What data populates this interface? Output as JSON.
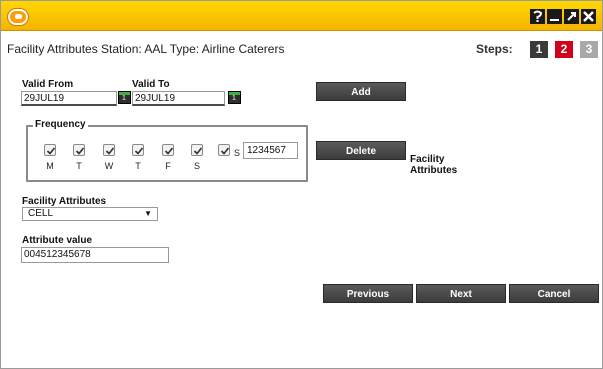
{
  "header": {
    "title": "Facility Attributes Station: AAL Type: Airline Caterers",
    "steps_label": "Steps:",
    "steps": [
      "1",
      "2",
      "3"
    ]
  },
  "window_controls": [
    "help",
    "minimize",
    "maximize",
    "close"
  ],
  "form": {
    "valid_from": {
      "label": "Valid From",
      "value": "29JUL19"
    },
    "valid_to": {
      "label": "Valid To",
      "value": "29JUL19"
    },
    "frequency": {
      "legend": "Frequency",
      "days": [
        {
          "label": "M",
          "checked": true
        },
        {
          "label": "T",
          "checked": true
        },
        {
          "label": "W",
          "checked": true
        },
        {
          "label": "T",
          "checked": true
        },
        {
          "label": "F",
          "checked": true
        },
        {
          "label": "S",
          "checked": true
        },
        {
          "label": "S",
          "checked": true
        }
      ],
      "value": "1234567"
    },
    "facility_attributes": {
      "label": "Facility Attributes",
      "selected": "CELL"
    },
    "attribute_value": {
      "label": "Attribute value",
      "value": "004512345678"
    },
    "side_label": "Facility Attributes"
  },
  "buttons": {
    "add": "Add",
    "delete": "Delete",
    "previous": "Previous",
    "next": "Next",
    "cancel": "Cancel"
  },
  "colors": {
    "titlebar": "#f5b400",
    "step_active": "#d0021b",
    "step_done": "#3a3a3a",
    "step_pending": "#a8a8a8"
  }
}
